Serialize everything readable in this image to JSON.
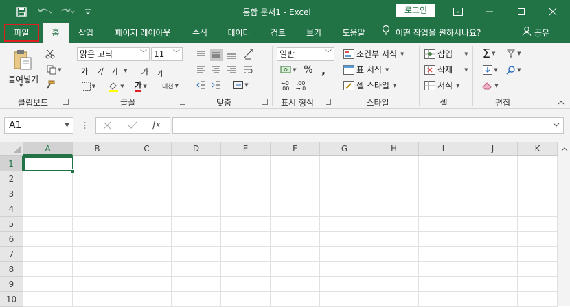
{
  "titlebar": {
    "title": "통합 문서1  -  Excel",
    "login_label": "로그인",
    "bg_color": "#217346"
  },
  "tabs": [
    {
      "label": "파일"
    },
    {
      "label": "홈"
    },
    {
      "label": "삽입"
    },
    {
      "label": "페이지 레이아웃"
    },
    {
      "label": "수식"
    },
    {
      "label": "데이터"
    },
    {
      "label": "검토"
    },
    {
      "label": "보기"
    },
    {
      "label": "도움말"
    }
  ],
  "tell_me": "어떤 작업을 원하시나요?",
  "share_label": "공유",
  "ribbon": {
    "clipboard": {
      "paste_label": "붙여넣기",
      "group_label": "클립보드"
    },
    "font": {
      "font_name": "맑은 고딕",
      "font_size": "11",
      "group_label": "글꼴",
      "bold": "가",
      "italic": "가",
      "underline": "가",
      "grow": "가",
      "shrink": "가",
      "phonetic": "내천",
      "font_color_glyph": "가"
    },
    "alignment": {
      "group_label": "맞춤"
    },
    "number": {
      "format": "일반",
      "group_label": "표시 형식"
    },
    "styles": {
      "conditional": "조건부 서식",
      "table": "표 서식",
      "cell": "셀 스타일",
      "group_label": "스타일"
    },
    "cells": {
      "insert": "삽입",
      "delete": "삭제",
      "format": "서식",
      "group_label": "셀"
    },
    "editing": {
      "group_label": "편집"
    }
  },
  "formula_bar": {
    "name_box": "A1",
    "fx": "fx",
    "formula": ""
  },
  "grid": {
    "columns": [
      "A",
      "B",
      "C",
      "D",
      "E",
      "F",
      "G",
      "H",
      "I",
      "J",
      "K"
    ],
    "rows": [
      "1",
      "2",
      "3",
      "4",
      "5",
      "6",
      "7",
      "8",
      "9",
      "10"
    ],
    "active_cell": "A1"
  }
}
